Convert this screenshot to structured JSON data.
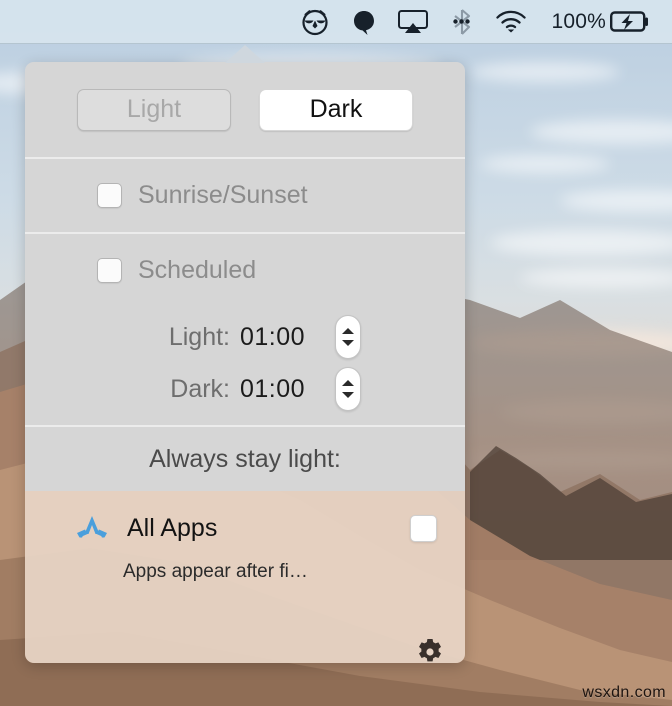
{
  "menubar": {
    "items": [
      {
        "name": "night-owl-icon",
        "label": ""
      },
      {
        "name": "droplet-icon",
        "label": ""
      },
      {
        "name": "airplay-icon",
        "label": ""
      },
      {
        "name": "bluetooth-icon",
        "label": ""
      },
      {
        "name": "wifi-icon",
        "label": ""
      }
    ],
    "battery_percent": "100%",
    "battery_state": "charging"
  },
  "popover": {
    "mode": {
      "light_label": "Light",
      "dark_label": "Dark",
      "selected": "Dark"
    },
    "sunrise": {
      "label": "Sunrise/Sunset",
      "checked": false
    },
    "scheduled": {
      "label": "Scheduled",
      "checked": false,
      "light_label": "Light:",
      "light_time": "01:00",
      "dark_label": "Dark:",
      "dark_time": "01:00"
    },
    "stay_light_header": "Always stay light:",
    "apps": {
      "rows": [
        {
          "name": "All Apps",
          "icon": "app-store-icon",
          "checked": false
        }
      ],
      "hint": "Apps appear after fi…"
    },
    "settings_icon": "gear-icon"
  },
  "watermark": "wsxdn.com",
  "colors": {
    "panel_gray": "#d6d6d6",
    "panel_warm": "#e8d5c6",
    "menubar": "#d6e4ee",
    "accent_blue": "#4a9fdc"
  }
}
